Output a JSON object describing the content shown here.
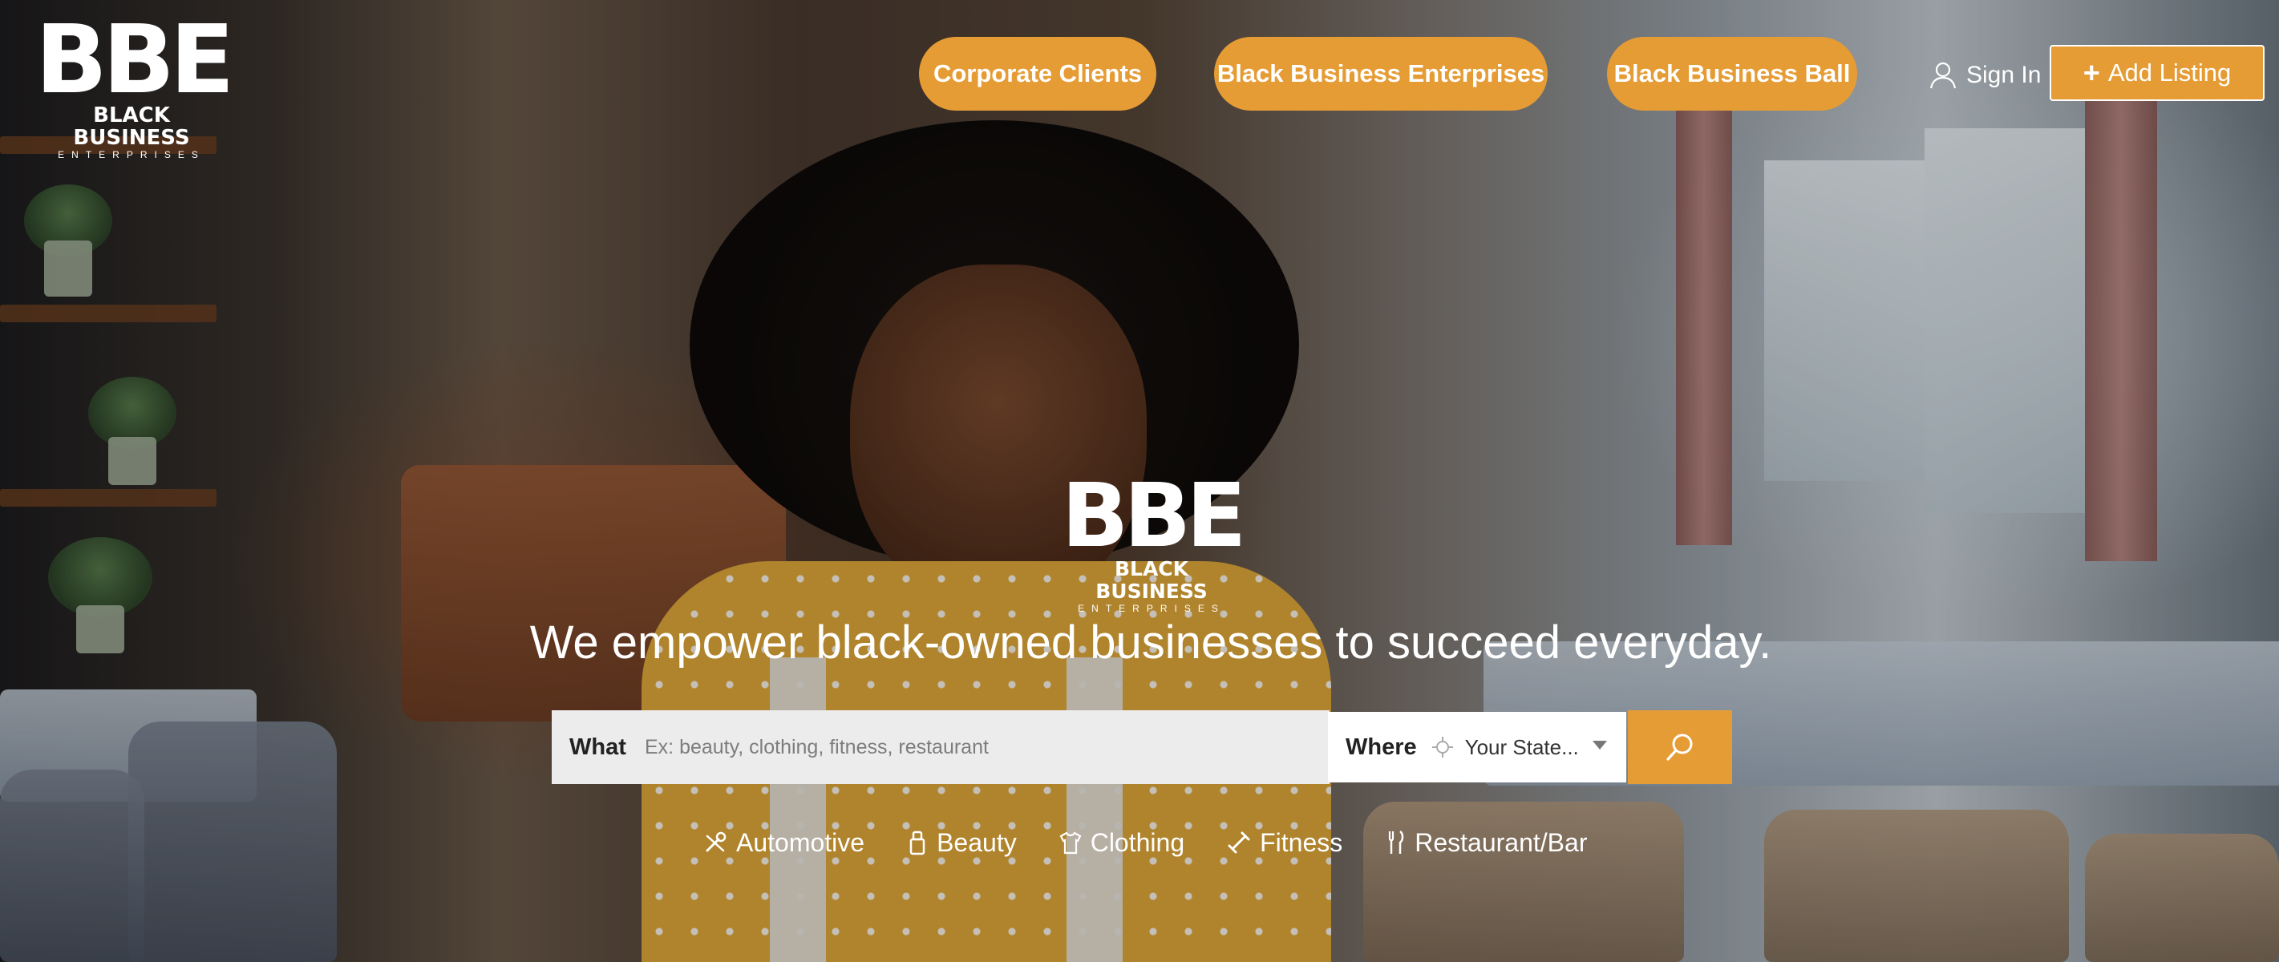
{
  "brand": {
    "logo_mark": "BBE",
    "logo_name": "BLACK BUSINESS",
    "logo_sub": "ENTERPRISES"
  },
  "nav": {
    "items": [
      {
        "label": "Corporate Clients"
      },
      {
        "label": "Black Business Enterprises"
      },
      {
        "label": "Black Business Ball"
      }
    ],
    "sign_in": "Sign In",
    "add_listing": "Add Listing"
  },
  "hero": {
    "tagline": "We empower black-owned businesses to succeed everyday."
  },
  "search": {
    "what_label": "What",
    "what_placeholder": "Ex: beauty, clothing, fitness, restaurant",
    "where_label": "Where",
    "where_value": "Your State..."
  },
  "categories": [
    {
      "label": "Automotive",
      "icon": "wrench-icon"
    },
    {
      "label": "Beauty",
      "icon": "beauty-icon"
    },
    {
      "label": "Clothing",
      "icon": "shirt-icon"
    },
    {
      "label": "Fitness",
      "icon": "dumbbell-icon"
    },
    {
      "label": "Restaurant/Bar",
      "icon": "fork-knife-icon"
    }
  ],
  "colors": {
    "accent": "#e69c35",
    "text_on_accent": "#ffffff"
  }
}
